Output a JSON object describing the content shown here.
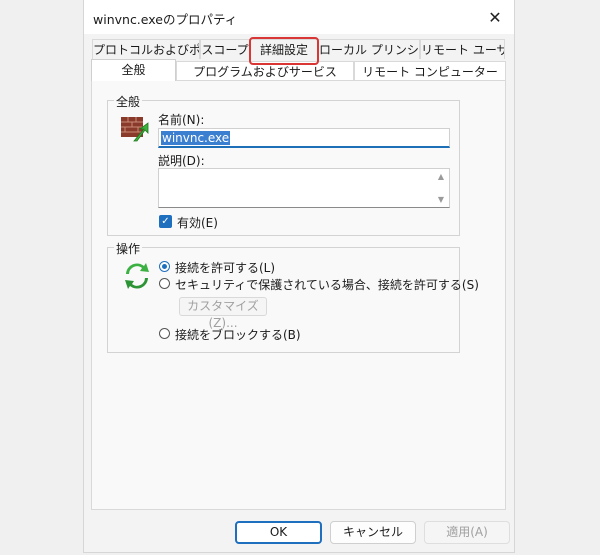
{
  "window": {
    "title": "winvnc.exeのプロパティ",
    "close_label": "✕"
  },
  "tabs_top_row": [
    "プロトコルおよびポート",
    "スコープ",
    "詳細設定",
    "ローカル プリンシパル",
    "リモート ユーザー"
  ],
  "tabs_bottom_row": [
    "全般",
    "プログラムおよびサービス",
    "リモート コンピューター"
  ],
  "highlighted_tab": "詳細設定",
  "general_group": {
    "label": "全般",
    "name_label": "名前(N):",
    "name_value": "winvnc.exe",
    "description_label": "説明(D):",
    "description_value": "",
    "enabled_label": "有効(E)",
    "enabled_checked": true,
    "icon": "firewall-brick-icon"
  },
  "action_group": {
    "label": "操作",
    "icon": "recycle-arrows-icon",
    "options": [
      "接続を許可する(L)",
      "セキュリティで保護されている場合、接続を許可する(S)",
      "接続をブロックする(B)"
    ],
    "selected_index": 0,
    "customize_button": "カスタマイズ(Z)..."
  },
  "footer": {
    "ok": "OK",
    "cancel": "キャンセル",
    "apply": "適用(A)"
  },
  "colors": {
    "accent": "#1f6fbf",
    "highlight_box": "#d93636"
  }
}
